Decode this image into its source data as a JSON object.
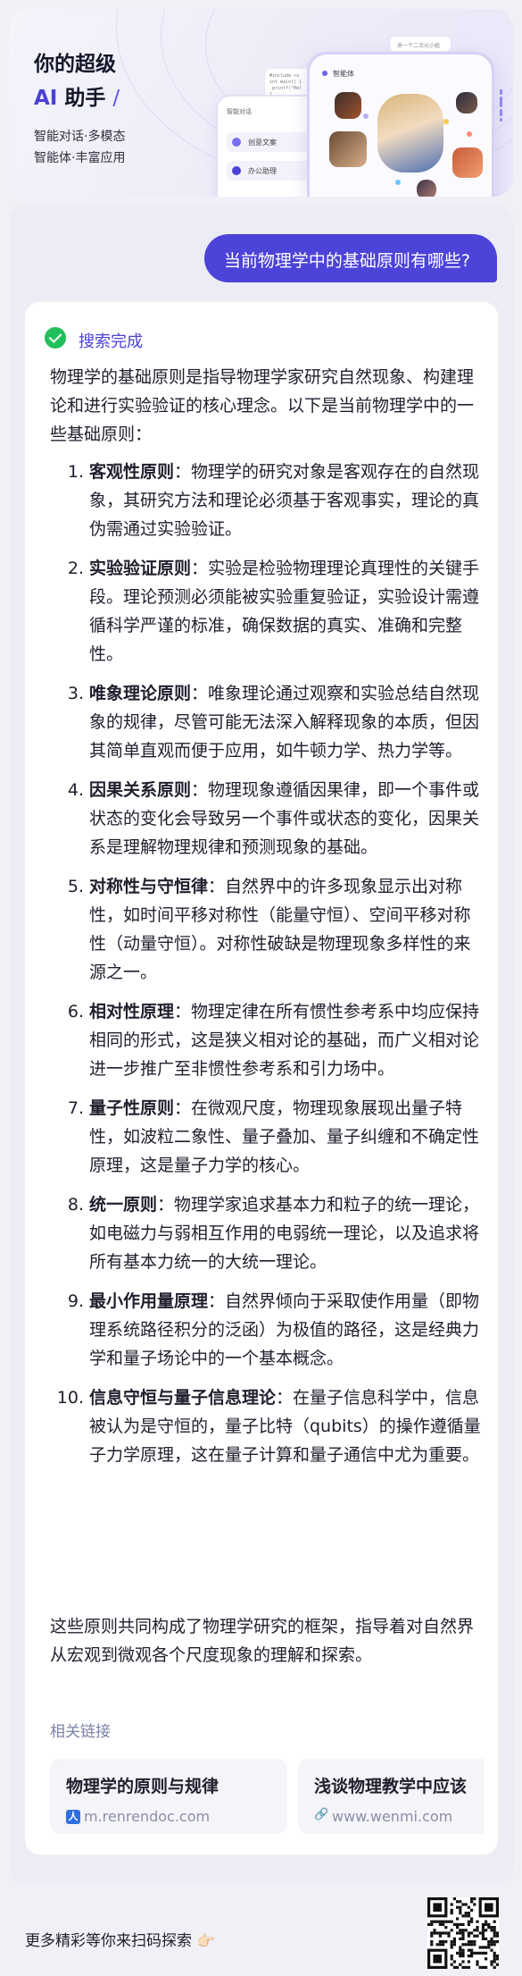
{
  "banner": {
    "title_line1": "你的超级",
    "title_ai": "AI",
    "title_rest": " 助手",
    "slash": "/",
    "subtitle_line1": "智能对话·多模态",
    "subtitle_line2": "智能体·丰富应用",
    "mock_back_header": "智能对话",
    "mock_back_item1": "创意文案",
    "mock_back_item2": "办公助理",
    "mock_front_header": "智能体",
    "mock_bubble": "来一个二次元小姐"
  },
  "chat": {
    "user_message": "当前物理学中的基础原则有哪些?",
    "status": "搜索完成",
    "intro": "物理学的基础原则是指导物理学家研究自然现象、构建理论和进行实验验证的核心理念。以下是当前物理学中的一些基础原则：",
    "principles": [
      {
        "num": "1.",
        "term": "客观性原则",
        "desc": "：物理学的研究对象是客观存在的自然现象，其研究方法和理论必须基于客观事实，理论的真伪需通过实验验证。"
      },
      {
        "num": "2.",
        "term": "实验验证原则",
        "desc": "：实验是检验物理理论真理性的关键手段。理论预测必须能被实验重复验证，实验设计需遵循科学严谨的标准，确保数据的真实、准确和完整性。"
      },
      {
        "num": "3.",
        "term": "唯象理论原则",
        "desc": "：唯象理论通过观察和实验总结自然现象的规律，尽管可能无法深入解释现象的本质，但因其简单直观而便于应用，如牛顿力学、热力学等。"
      },
      {
        "num": "4.",
        "term": "因果关系原则",
        "desc": "：物理现象遵循因果律，即一个事件或状态的变化会导致另一个事件或状态的变化，因果关系是理解物理规律和预测现象的基础。"
      },
      {
        "num": "5.",
        "term": "对称性与守恒律",
        "desc": "：自然界中的许多现象显示出对称性，如时间平移对称性（能量守恒）、空间平移对称性（动量守恒）。对称性破缺是物理现象多样性的来源之一。"
      },
      {
        "num": "6.",
        "term": "相对性原理",
        "desc": "：物理定律在所有惯性参考系中均应保持相同的形式，这是狭义相对论的基础，而广义相对论进一步推广至非惯性参考系和引力场中。"
      },
      {
        "num": "7.",
        "term": "量子性原则",
        "desc": "：在微观尺度，物理现象展现出量子特性，如波粒二象性、量子叠加、量子纠缠和不确定性原理，这是量子力学的核心。"
      },
      {
        "num": "8.",
        "term": "统一原则",
        "desc": "：物理学家追求基本力和粒子的统一理论，如电磁力与弱相互作用的电弱统一理论，以及追求将所有基本力统一的大统一理论。"
      },
      {
        "num": "9.",
        "term": "最小作用量原理",
        "desc": "：自然界倾向于采取使作用量（即物理系统路径积分的泛函）为极值的路径，这是经典力学和量子场论中的一个基本概念。"
      },
      {
        "num": "10.",
        "term": "信息守恒与量子信息理论",
        "desc": "：在量子信息科学中，信息被认为是守恒的，量子比特（qubits）的操作遵循量子力学原理，这在量子计算和量子通信中尤为重要。"
      }
    ],
    "outro": "这些原则共同构成了物理学研究的框架，指导着对自然界从宏观到微观各个尺度现象的理解和探索。",
    "related_label": "相关链接",
    "links": [
      {
        "title": "物理学的原则与规律",
        "site": "m.renrendoc.com",
        "icon_glyph": "人",
        "icon": "renrendoc-icon"
      },
      {
        "title": "浅谈物理教学中应该",
        "site": "www.wenmi.com",
        "icon": "link-icon"
      }
    ]
  },
  "footer": {
    "text": "更多精彩等你来扫码探索 👉🏻"
  },
  "colors": {
    "accent": "#4c43d9",
    "success": "#1fbf5a",
    "muted": "#7b82a8"
  }
}
